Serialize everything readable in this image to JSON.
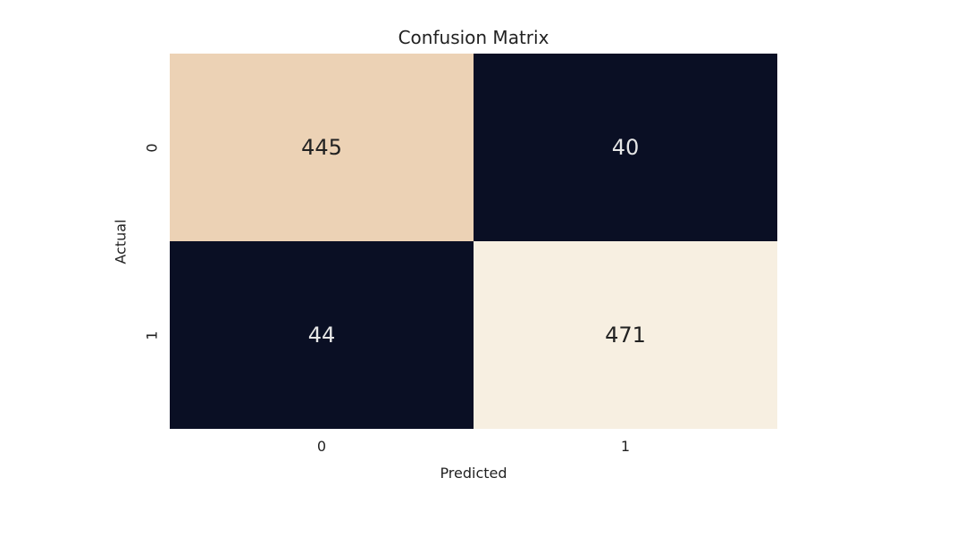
{
  "chart_data": {
    "type": "heatmap",
    "title": "Confusion Matrix",
    "xlabel": "Predicted",
    "ylabel": "Actual",
    "x_categories": [
      "0",
      "1"
    ],
    "y_categories": [
      "0",
      "1"
    ],
    "values": [
      [
        445,
        40
      ],
      [
        44,
        471
      ]
    ],
    "cell_colors": [
      [
        "#ecd2b5",
        "#0a0f24"
      ],
      [
        "#0a0f24",
        "#f7efe1"
      ]
    ],
    "text_colors": [
      [
        "#222222",
        "#e6e6e6"
      ],
      [
        "#e6e6e6",
        "#222222"
      ]
    ]
  }
}
